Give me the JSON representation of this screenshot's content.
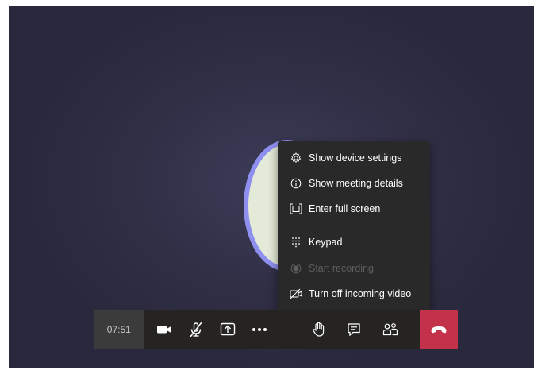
{
  "menu": {
    "items": [
      {
        "label": "Show device settings",
        "icon": "gear-icon",
        "enabled": true
      },
      {
        "label": "Show meeting details",
        "icon": "info-icon",
        "enabled": true
      },
      {
        "label": "Enter full screen",
        "icon": "fullscreen-icon",
        "enabled": true
      },
      {
        "label": "Keypad",
        "icon": "keypad-icon",
        "enabled": true
      },
      {
        "label": "Start recording",
        "icon": "record-icon",
        "enabled": false
      },
      {
        "label": "Turn off incoming video",
        "icon": "video-off-icon",
        "enabled": true
      }
    ]
  },
  "callbar": {
    "timer": "07:51",
    "buttons": [
      {
        "name": "camera",
        "icon": "camera-icon"
      },
      {
        "name": "microphone",
        "icon": "mic-muted-icon"
      },
      {
        "name": "share",
        "icon": "share-screen-icon"
      },
      {
        "name": "more",
        "icon": "more-icon"
      },
      {
        "name": "raise-hand",
        "icon": "hand-icon"
      },
      {
        "name": "chat",
        "icon": "chat-icon"
      },
      {
        "name": "participants",
        "icon": "people-icon"
      },
      {
        "name": "hang-up",
        "icon": "phone-hangup-icon"
      }
    ]
  },
  "colors": {
    "stage_bg": "#302f46",
    "menu_bg": "#292929",
    "avatar_ring": "#8f8ff0",
    "hangup": "#c4314b",
    "timer_bg": "#3b3b3b"
  }
}
